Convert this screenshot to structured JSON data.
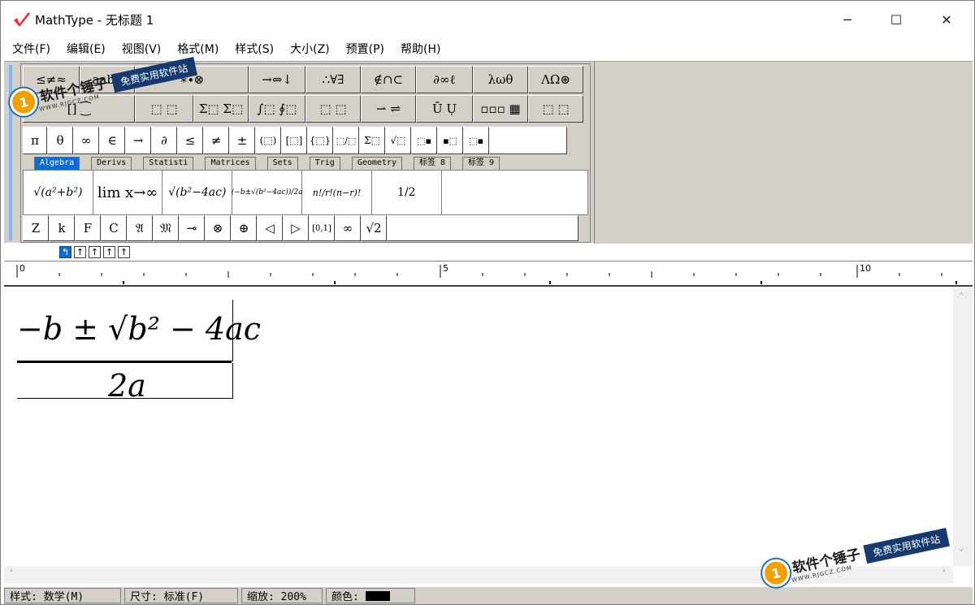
{
  "window": {
    "title": "MathType - 无标题 1",
    "controls": {
      "minimize": "─",
      "maximize": "☐",
      "close": "✕"
    }
  },
  "menu": [
    "文件(F)",
    "编辑(E)",
    "视图(V)",
    "格式(M)",
    "样式(S)",
    "大小(Z)",
    "预置(P)",
    "帮助(H)"
  ],
  "palette_row1": [
    "≤≠≈",
    "ạab∴",
    "∗∙⊗",
    "→⇔↓",
    "∴∀∃",
    "∉∩⊂",
    "∂∞ℓ",
    "λωθ",
    "ΛΩ⊛"
  ],
  "palette_row2": [
    "[]  ⁐",
    "⬚ ⬚",
    "Σ⬚ Σ⬚",
    "∫⬚ ∮⬚",
    "⬚ ⬚",
    "⇀ ⇌",
    "Ū Ụ",
    "▫▫▫ ▦",
    "⬚ ⬚"
  ],
  "symbols_row": [
    "π",
    "θ",
    "∞",
    "∈",
    "→",
    "∂",
    "≤",
    "≠",
    "±",
    "(⬚)",
    "[⬚]",
    "{⬚}",
    "⬚/⬚",
    "Σ⬚",
    "√⬚",
    "⬚▪",
    "▪⬚",
    "⬚▪"
  ],
  "tabs": [
    "Algebra",
    "Derivs",
    "Statisti",
    "Matrices",
    "Sets",
    "Trig",
    "Geometry",
    "标签 8",
    "标签 9"
  ],
  "active_tab": "Algebra",
  "templates": [
    "√(a²+b²)",
    "lim x→∞",
    "√(b²−4ac)",
    "(−b±√(b²−4ac))/2a",
    "n!/r!(n−r)!",
    "1/2"
  ],
  "bottom_row": [
    "Z",
    "k",
    "F",
    "C",
    "𝔄",
    "𝔐",
    "⊸",
    "⊗",
    "⊕",
    "◁",
    "▷",
    "[0,1]",
    "∞",
    "√2"
  ],
  "nudge_buttons": [
    "↰",
    "↑",
    "↑",
    "↑",
    "↑"
  ],
  "ruler": {
    "marks": [
      "0",
      "5",
      "10"
    ]
  },
  "equation": {
    "numerator": "−b ± √b² − 4ac",
    "denominator": "2a"
  },
  "status": {
    "style": "样式: 数学(M)",
    "size": "尺寸: 标准(F)",
    "zoom": "缩放: 200%",
    "color": "颜色:"
  },
  "watermark": {
    "title": "软件个锤子",
    "url": "WWW.RJGCZ.COM",
    "tagline": "免费实用软件站"
  },
  "colors": {
    "accent": "#0a6cd6",
    "brand": "#e8373c",
    "chrome": "#d4d0c8"
  }
}
